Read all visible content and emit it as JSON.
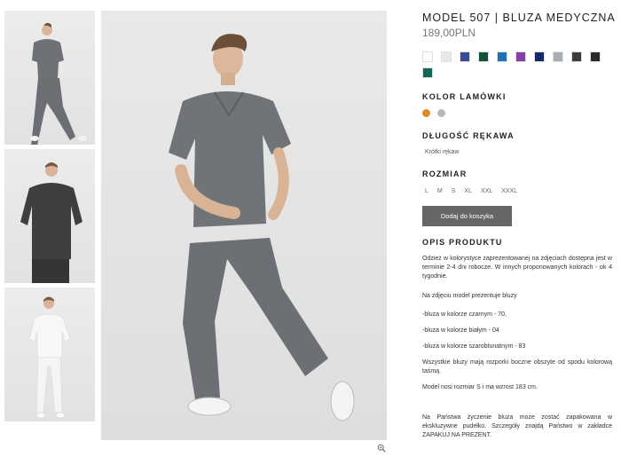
{
  "gallery": {
    "thumbnails": [
      {
        "alt_icon": "model-walking-thumbnail"
      },
      {
        "alt_icon": "model-front-thumbnail"
      },
      {
        "alt_icon": "model-white-thumbnail"
      }
    ],
    "zoom_icon": "magnifier-icon"
  },
  "product": {
    "title": "MODEL 507 | BLUZA MEDYCZNA",
    "price": "189,00PLN",
    "colors": [
      "#ffffff",
      "#e8e8e8",
      "#3a4a9a",
      "#15523a",
      "#1f72b8",
      "#8a3fa8",
      "#142a6a",
      "#a8aeb3",
      "#3a3d3c",
      "#2a2a2a",
      "#0d6a58"
    ],
    "piping_label": "KOLOR LAMÓWKI",
    "piping_colors": [
      "#e3892b",
      "#b4b9bd"
    ],
    "sleeve_label": "DŁUGOŚĆ RĘKAWA",
    "sleeve_value": "Krótki rękaw",
    "size_label": "ROZMIAR",
    "sizes": [
      "L",
      "M",
      "S",
      "XL",
      "XXL",
      "XXXL"
    ],
    "add_to_cart": "Dodaj do koszyka",
    "description_label": "OPIS PRODUKTU",
    "description": [
      "Odzież w kolorystyce zaprezentowanej na zdjęciach dostępna jest w terminie 2-4 dni robocze.  W innych proponowanych kolorach -  ok 4 tygodnie.",
      "Na zdjęciu model prezentuje bluzy",
      "-bluza w kolorze czarnym - 70,",
      "-bluza w kolorze białym - 04",
      "-bluza w kolorze szarobtunatnym - 83",
      "Wszystkie bluzy mają rozporki boczne obszyte od spodu  kolorową taśmą.",
      "Model nosi rozmiar S i ma wzrost 183 cm.",
      "Na Państwa życzenie bluza  może zostać zapakowana w ekskluzywne pudełko. Szczegóły znajdą Państwo w zakładce ZAPAKUJ NA PREZENT."
    ]
  }
}
